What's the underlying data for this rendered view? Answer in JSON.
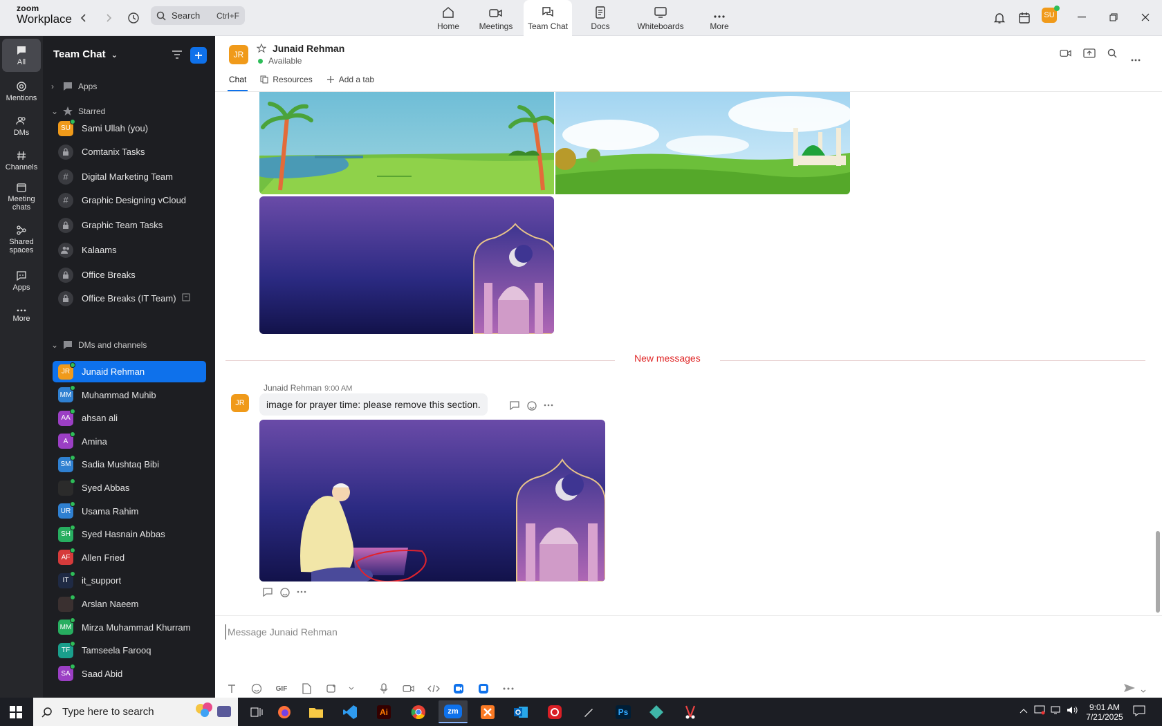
{
  "app": {
    "logo_line1": "zoom",
    "logo_line2": "Workplace"
  },
  "topbar": {
    "search_label": "Search",
    "search_shortcut": "Ctrl+F",
    "tabs": [
      {
        "label": "Home"
      },
      {
        "label": "Meetings"
      },
      {
        "label": "Team Chat"
      },
      {
        "label": "Docs"
      },
      {
        "label": "Whiteboards"
      },
      {
        "label": "More"
      }
    ],
    "user_initials": "SU"
  },
  "rail": [
    {
      "label": "All"
    },
    {
      "label": "Mentions"
    },
    {
      "label": "DMs"
    },
    {
      "label": "Channels"
    },
    {
      "label": "Meeting chats"
    },
    {
      "label": "Shared spaces"
    },
    {
      "label": "Apps"
    },
    {
      "label": "More"
    }
  ],
  "sidebar": {
    "title": "Team Chat",
    "sections": {
      "apps": "Apps",
      "starred": "Starred",
      "dms": "DMs and channels"
    },
    "starred": [
      {
        "label": "Sami Ullah (you)",
        "initials": "SU",
        "color": "#f09a1a"
      },
      {
        "label": "Comtanix Tasks"
      },
      {
        "label": "Digital Marketing Team"
      },
      {
        "label": "Graphic Designing vCloud"
      },
      {
        "label": "Graphic Team Tasks"
      },
      {
        "label": "Kalaams"
      },
      {
        "label": "Office Breaks"
      },
      {
        "label": "Office Breaks (IT Team)"
      }
    ],
    "dms": [
      {
        "label": "Junaid Rehman",
        "initials": "JR",
        "color": "#f09a1a"
      },
      {
        "label": "Muhammad Muhib",
        "initials": "MM",
        "color": "#2f80d1"
      },
      {
        "label": "ahsan ali",
        "initials": "AA",
        "color": "#9b3fc4"
      },
      {
        "label": "Amina",
        "initials": "A",
        "color": "#9b3fc4"
      },
      {
        "label": "Sadia Mushtaq Bibi",
        "initials": "SM",
        "color": "#2f80d1"
      },
      {
        "label": "Syed Abbas",
        "initials": "",
        "color": "#2b2b2b"
      },
      {
        "label": "Usama Rahim",
        "initials": "UR",
        "color": "#2f80d1"
      },
      {
        "label": "Syed Hasnain Abbas",
        "initials": "SH",
        "color": "#27ae60"
      },
      {
        "label": "Allen Fried",
        "initials": "AF",
        "color": "#d63b3b"
      },
      {
        "label": "it_support",
        "initials": "IT",
        "color": "#1f2a44"
      },
      {
        "label": "Arslan Naeem",
        "initials": "",
        "color": "#3a3030"
      },
      {
        "label": "Mirza Muhammad Khurram",
        "initials": "MM",
        "color": "#27ae60"
      },
      {
        "label": "Tamseela Farooq",
        "initials": "TF",
        "color": "#1a9f8c"
      },
      {
        "label": "Saad Abid",
        "initials": "SA",
        "color": "#9b3fc4"
      }
    ]
  },
  "chat_header": {
    "initials": "JR",
    "name": "Junaid Rehman",
    "status": "Available",
    "tabs": [
      {
        "label": "Chat"
      },
      {
        "label": "Resources"
      },
      {
        "label": "Add a tab"
      }
    ]
  },
  "chat": {
    "divider": "New messages",
    "message": {
      "initials": "JR",
      "sender": "Junaid Rehman",
      "time": "9:00 AM",
      "text": "image for prayer time: please remove this section."
    }
  },
  "composer": {
    "placeholder": "Message Junaid Rehman",
    "gif": "GIF"
  },
  "taskbar": {
    "search": "Type here to search",
    "time": "9:01 AM",
    "date": "7/21/2025"
  },
  "colors": {
    "accent": "#0e71eb",
    "new_messages": "#e02828",
    "online": "#2ebd59"
  }
}
